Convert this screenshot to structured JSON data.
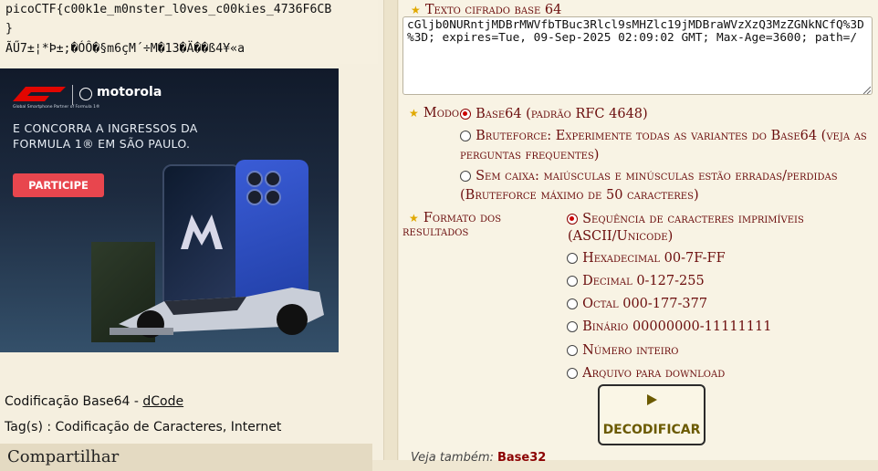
{
  "result": {
    "line1": "picoCTF{c00k1e_m0nster_l0ves_c00kies_4736F6CB",
    "line2": "}",
    "line3": "ÃŰ7±¦*Þ±;�ÓÔ�§m6çM´÷M�13�Ä��ß4¥«a"
  },
  "ad": {
    "brand": "motorola",
    "sub": "Global Smartphone Partner of Formula 1®",
    "head1": "E CONCORRA A INGRESSOS DA",
    "head2": "FORMULA 1® EM SÃO PAULO.",
    "cta": "PARTICIPE"
  },
  "info": {
    "line1_text": "Codificação Base64 - ",
    "line1_link": "dCode",
    "line2": "Tag(s) : Codificação de Caracteres, Internet",
    "share": "Compartilhar"
  },
  "form": {
    "cipher_label": "Texto cifrado base 64",
    "cipher_value": "cGljb0NURntjMDBrMWVfbTBuc3Rlcl9sMHZlc19jMDBraWVzXzQ3MzZGNkNCfQ%3D%3D; expires=Tue, 09-Sep-2025 02:09:02 GMT; Max-Age=3600; path=/",
    "mode_label": "Modo",
    "mode_options": [
      "Base64 (padrão RFC 4648)",
      "Bruteforce: Experimente todas as variantes do Base64 (veja as",
      "perguntas frequentes)",
      "Sem caixa: maiúsculas e minúsculas estão erradas/perdidas",
      "(Bruteforce máximo de 50 caracteres)"
    ],
    "format_label_1": "Formato dos",
    "format_label_2": "resultados",
    "format_options": [
      "Sequência de caracteres imprimíveis",
      "(ASCII/Unicode)",
      "Hexadecimal 00-7F-FF",
      "Decimal 0-127-255",
      "Octal 000-177-377",
      "Binário 00000000-11111111",
      "Número inteiro",
      "Arquivo para download"
    ],
    "decode_label": "DECODIFICAR",
    "see_also_prefix": "Veja também: ",
    "see_also_link": "Base32"
  }
}
